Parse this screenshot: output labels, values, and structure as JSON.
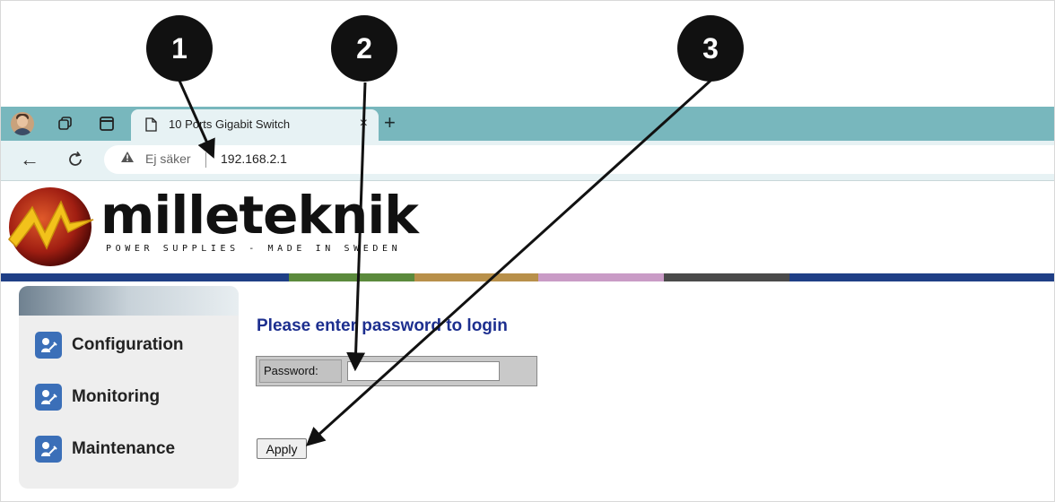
{
  "browser": {
    "tab_title": "10 Ports Gigabit Switch",
    "tab_close": "×",
    "new_tab": "+",
    "back": "←",
    "reload": "C",
    "security_warning": "Ej säker",
    "url": "192.168.2.1"
  },
  "logo": {
    "brand": "milleteknik",
    "tagline": "POWER SUPPLIES - MADE IN SWEDEN"
  },
  "colorbar_colors": [
    "#1f3f86",
    "#5b8a3c",
    "#b8904a",
    "#c99bc6",
    "#4a4a4a",
    "#1f3f86"
  ],
  "sidebar": {
    "items": [
      {
        "label": "Configuration",
        "icon": "tools-icon"
      },
      {
        "label": "Monitoring",
        "icon": "tools-icon"
      },
      {
        "label": "Maintenance",
        "icon": "tools-icon"
      }
    ]
  },
  "login": {
    "title": "Please enter password to login",
    "password_label": "Password:",
    "password_value": "",
    "apply_label": "Apply"
  },
  "callouts": [
    "1",
    "2",
    "3"
  ],
  "colors": {
    "tabstrip": "#78b7bd",
    "title_blue": "#1d2f8f",
    "sidebar_icon": "#3b6fb8"
  }
}
